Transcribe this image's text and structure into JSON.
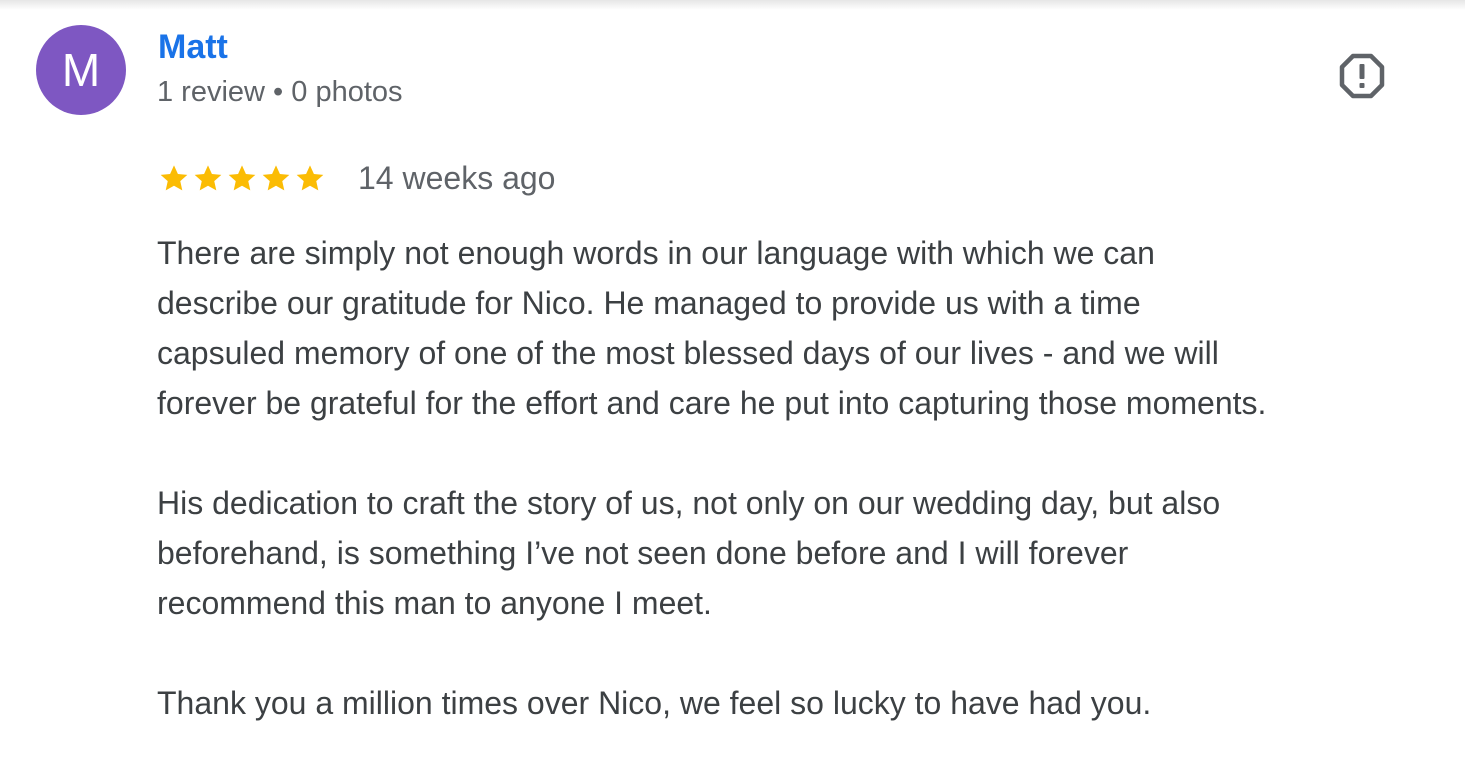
{
  "review": {
    "author": {
      "initial": "M",
      "name": "Matt",
      "meta": "1 review • 0 photos",
      "avatar_color": "#7e57c2"
    },
    "rating": 5,
    "rating_max": 5,
    "time_ago": "14 weeks ago",
    "paragraphs": [
      "There are simply not enough words in our language with which we can\ndescribe our gratitude for Nico. He managed to provide us with a time\ncapsuled memory of one of the most blessed days of our lives - and we will\nforever be grateful for the effort and care he put into capturing those moments.",
      "His dedication to craft the story of us, not only on our wedding day, but also\nbeforehand, is something I’ve not seen done before and I will forever\nrecommend this man to anyone I meet.",
      "Thank you a million times over Nico, we feel so lucky to have had you."
    ]
  },
  "icons": {
    "flag": "report-flag-icon",
    "star": "star-icon"
  },
  "colors": {
    "link_blue": "#1a73e8",
    "star_gold": "#fbbc04",
    "secondary_text": "#5f6368",
    "body_text": "#3c4043"
  }
}
